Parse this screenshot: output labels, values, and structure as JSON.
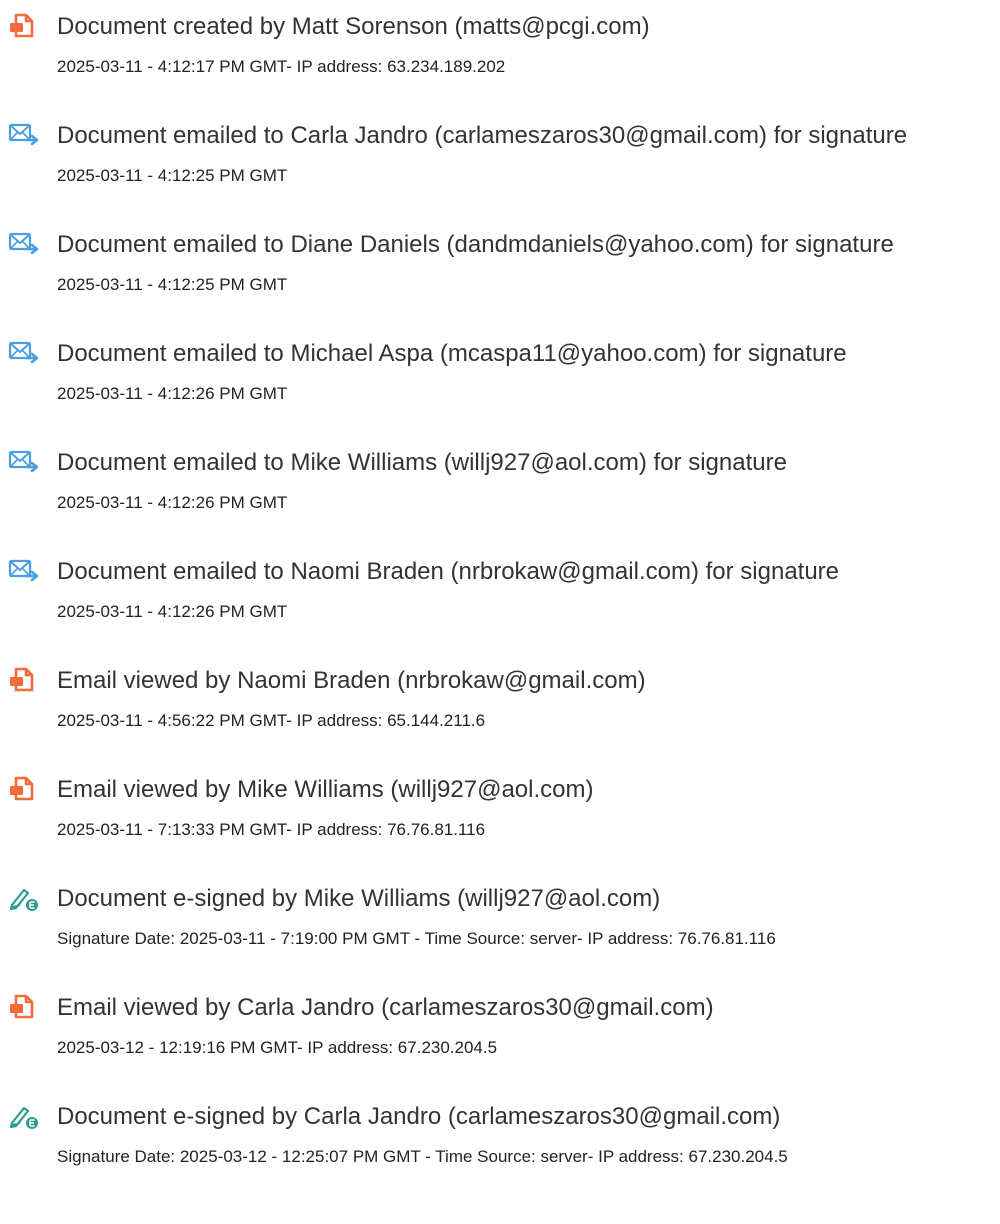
{
  "events": [
    {
      "icon": "document-created-icon",
      "title": "Document created by Matt Sorenson (matts@pcgi.com)",
      "detail": "2025-03-11 - 4:12:17 PM GMT- IP address: 63.234.189.202"
    },
    {
      "icon": "email-sent-icon",
      "title": "Document emailed to Carla Jandro (carlameszaros30@gmail.com) for signature",
      "detail": "2025-03-11 - 4:12:25 PM GMT"
    },
    {
      "icon": "email-sent-icon",
      "title": "Document emailed to Diane Daniels (dandmdaniels@yahoo.com) for signature",
      "detail": "2025-03-11 - 4:12:25 PM GMT"
    },
    {
      "icon": "email-sent-icon",
      "title": "Document emailed to Michael Aspa (mcaspa11@yahoo.com) for signature",
      "detail": "2025-03-11 - 4:12:26 PM GMT"
    },
    {
      "icon": "email-sent-icon",
      "title": "Document emailed to Mike Williams (willj927@aol.com) for signature",
      "detail": "2025-03-11 - 4:12:26 PM GMT"
    },
    {
      "icon": "email-sent-icon",
      "title": "Document emailed to Naomi Braden (nrbrokaw@gmail.com) for signature",
      "detail": "2025-03-11 - 4:12:26 PM GMT"
    },
    {
      "icon": "document-viewed-icon",
      "title": "Email viewed by Naomi Braden (nrbrokaw@gmail.com)",
      "detail": "2025-03-11 - 4:56:22 PM GMT- IP address: 65.144.211.6"
    },
    {
      "icon": "document-viewed-icon",
      "title": "Email viewed by Mike Williams (willj927@aol.com)",
      "detail": "2025-03-11 - 7:13:33 PM GMT- IP address: 76.76.81.116"
    },
    {
      "icon": "e-signed-icon",
      "title": "Document e-signed by Mike Williams (willj927@aol.com)",
      "detail": "Signature Date: 2025-03-11 - 7:19:00 PM GMT - Time Source: server- IP address: 76.76.81.116"
    },
    {
      "icon": "document-viewed-icon",
      "title": "Email viewed by Carla Jandro (carlameszaros30@gmail.com)",
      "detail": "2025-03-12 - 12:19:16 PM GMT- IP address: 67.230.204.5"
    },
    {
      "icon": "e-signed-icon",
      "title": "Document e-signed by Carla Jandro (carlameszaros30@gmail.com)",
      "detail": "Signature Date: 2025-03-12 - 12:25:07 PM GMT - Time Source: server- IP address: 67.230.204.5"
    }
  ],
  "colors": {
    "document_icon": "#f26b3a",
    "email_icon": "#4a9fe0",
    "sign_icon": "#2a9d8f",
    "title_text": "#333333",
    "detail_text": "#222222"
  }
}
